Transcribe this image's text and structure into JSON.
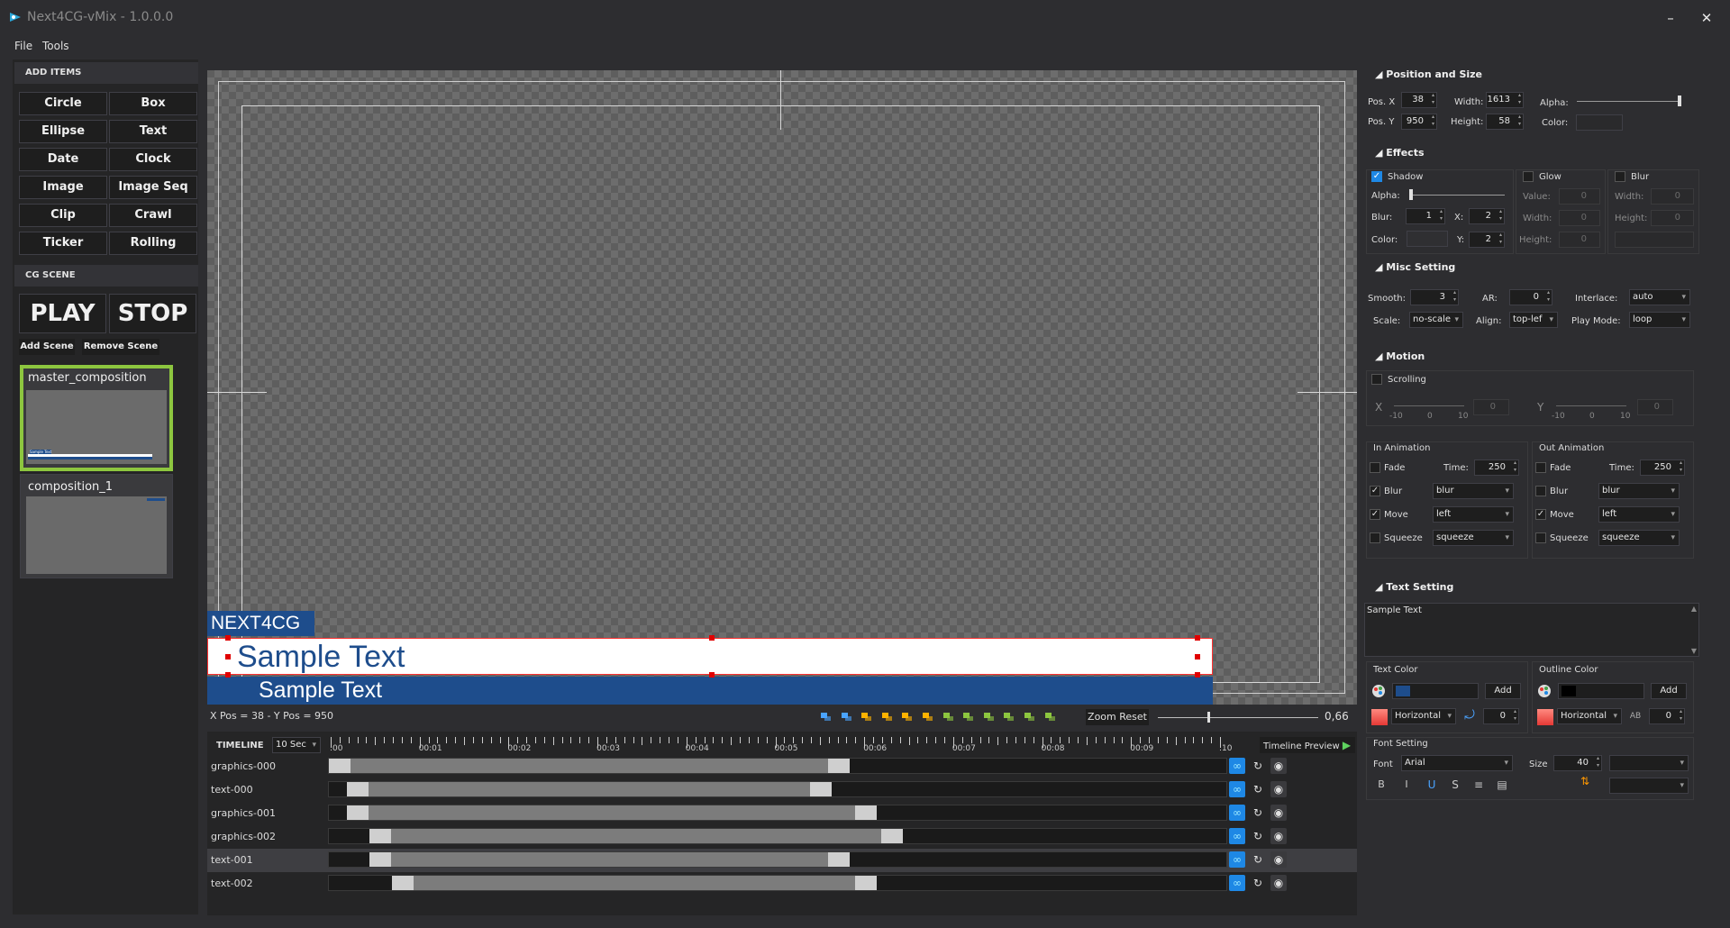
{
  "app": {
    "title": "Next4CG-vMix - 1.0.0.0",
    "minimize": "–",
    "close": "✕"
  },
  "menu": {
    "file": "File",
    "tools": "Tools"
  },
  "left": {
    "add_items_header": "ADD ITEMS",
    "items": [
      "Circle",
      "Box",
      "Ellipse",
      "Text",
      "Date",
      "Clock",
      "Image",
      "Image Seq",
      "Clip",
      "Crawl",
      "Ticker",
      "Rolling"
    ],
    "cg_scene_header": "CG SCENE",
    "play": "PLAY",
    "stop": "STOP",
    "add_scene": "Add Scene",
    "remove_scene": "Remove Scene",
    "scenes": [
      {
        "name": "master_composition",
        "thumb_label": "Sample Text"
      },
      {
        "name": "composition_1"
      }
    ]
  },
  "canvas": {
    "lower_third": {
      "tag": "NEXT4CG",
      "main": "Sample Text",
      "sub": "Sample Text"
    },
    "status": "X Pos = 38 - Y Pos = 950",
    "zoom_reset": "Zoom Reset",
    "zoom_value": "0,66",
    "zoom_level": 0.66
  },
  "timeline": {
    "label": "TIMELINE",
    "duration": "10 Sec",
    "preview": "Timeline Preview",
    "ticks": [
      ":00",
      "00:01",
      "00:02",
      "00:03",
      "00:04",
      "00:05",
      "00:06",
      "00:07",
      "00:08",
      "00:09",
      ":10"
    ],
    "tracks": [
      {
        "name": "graphics-000",
        "start": 0.0,
        "end": 0.58
      },
      {
        "name": "text-000",
        "start": 0.02,
        "end": 0.56
      },
      {
        "name": "graphics-001",
        "start": 0.02,
        "end": 0.61
      },
      {
        "name": "graphics-002",
        "start": 0.045,
        "end": 0.64
      },
      {
        "name": "text-001",
        "start": 0.045,
        "end": 0.58
      },
      {
        "name": "text-002",
        "start": 0.07,
        "end": 0.61
      }
    ],
    "selected_track": "text-001"
  },
  "right": {
    "pos_size": {
      "header": "Position and Size",
      "posx_label": "Pos. X",
      "posx": "38",
      "posy_label": "Pos. Y",
      "posy": "950",
      "width_label": "Width:",
      "width": "1613",
      "height_label": "Height:",
      "height": "58",
      "alpha_label": "Alpha:",
      "color_label": "Color:"
    },
    "effects": {
      "header": "Effects",
      "shadow": "Shadow",
      "glow": "Glow",
      "blur": "Blur",
      "alpha": "Alpha:",
      "blur_label": "Blur:",
      "blur_val": "1",
      "x_label": "X:",
      "x_val": "2",
      "y_label": "Y:",
      "y_val": "2",
      "color_label": "Color:",
      "value_label": "Value:",
      "value_val": "0",
      "width_label": "Width:",
      "width_val": "0",
      "height_label": "Height:",
      "height_val": "0"
    },
    "misc": {
      "header": "Misc Setting",
      "smooth_label": "Smooth:",
      "smooth": "3",
      "ar_label": "AR:",
      "ar": "0",
      "interlace_label": "Interlace:",
      "interlace": "auto",
      "scale_label": "Scale:",
      "scale": "no-scale",
      "align_label": "Align:",
      "align": "top-lef",
      "playmode_label": "Play Mode:",
      "playmode": "loop"
    },
    "motion": {
      "header": "Motion",
      "scrolling": "Scrolling",
      "x_label": "X",
      "y_label": "Y",
      "min": "-10",
      "mid": "0",
      "max": "10",
      "x_val": "0",
      "y_val": "0"
    },
    "in_anim": {
      "header": "In Animation",
      "fade": "Fade",
      "time_label": "Time:",
      "time": "250",
      "blur": "Blur",
      "blur_sel": "blur",
      "move": "Move",
      "move_sel": "left",
      "squeeze": "Squeeze",
      "squeeze_sel": "squeeze"
    },
    "out_anim": {
      "header": "Out Animation",
      "fade": "Fade",
      "time_label": "Time:",
      "time": "250",
      "blur": "Blur",
      "blur_sel": "blur",
      "move": "Move",
      "move_sel": "left",
      "squeeze": "Squeeze",
      "squeeze_sel": "squeeze"
    },
    "text_setting": {
      "header": "Text Setting",
      "text": "Sample Text"
    },
    "text_color": {
      "header": "Text Color",
      "add": "Add",
      "gradient": "Horizontal",
      "value": "0",
      "color": "#1e4d8c"
    },
    "outline_color": {
      "header": "Outline Color",
      "add": "Add",
      "gradient": "Horizontal",
      "value": "0",
      "color": "#000000"
    },
    "font": {
      "header": "Font Setting",
      "font_label": "Font",
      "font": "Arial",
      "size_label": "Size",
      "size": "40"
    }
  },
  "colors": {
    "accent_green": "#8dc63f",
    "brand_blue": "#1e4d8c",
    "selection_red": "#ff0000"
  }
}
